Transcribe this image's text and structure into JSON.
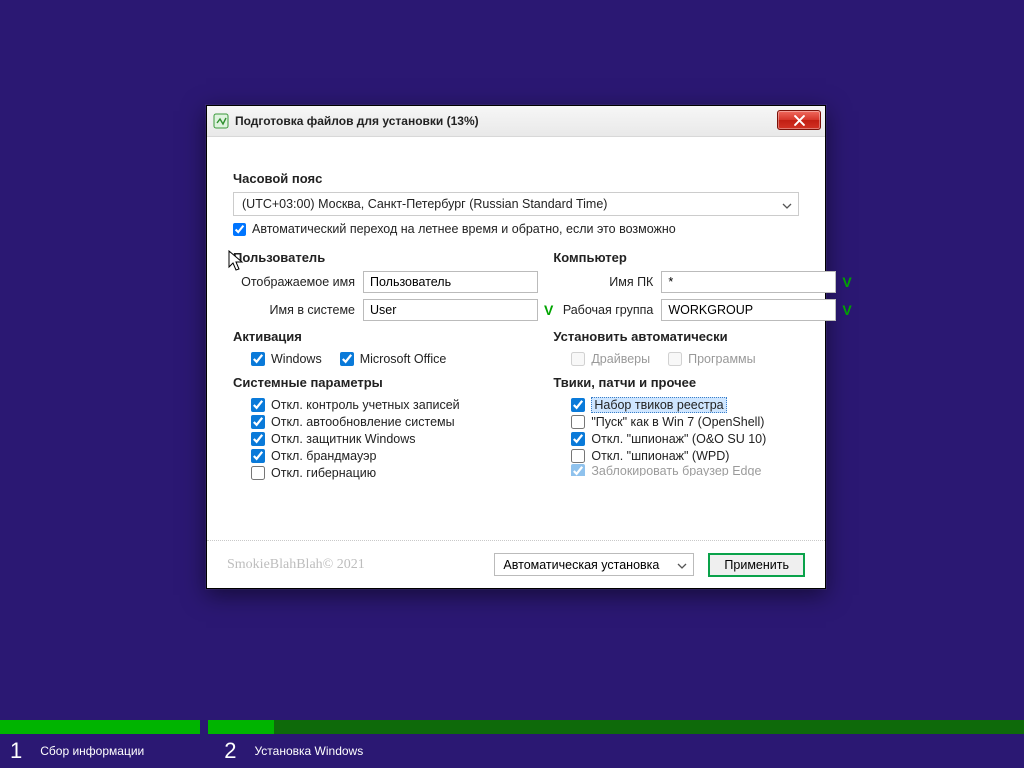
{
  "window": {
    "title": "Подготовка файлов для установки (13%)"
  },
  "timezone": {
    "heading": "Часовой пояс",
    "selected": "(UTC+03:00) Москва, Санкт-Петербург (Russian Standard Time)",
    "dst_checked": true,
    "dst_label": "Автоматический переход на летнее время и обратно, если это возможно"
  },
  "user": {
    "heading": "Пользователь",
    "display_label": "Отображаемое имя",
    "display_value": "Пользователь",
    "system_label": "Имя в системе",
    "system_value": "User",
    "valid_mark": "V"
  },
  "computer": {
    "heading": "Компьютер",
    "pc_label": "Имя ПК",
    "pc_value": "*",
    "wg_label": "Рабочая группа",
    "wg_value": "WORKGROUP",
    "valid_mark": "V"
  },
  "activation": {
    "heading": "Активация",
    "windows_label": "Windows",
    "windows_checked": true,
    "office_label": "Microsoft Office",
    "office_checked": true
  },
  "autoinstall": {
    "heading": "Установить автоматически",
    "drivers_label": "Драйверы",
    "drivers_checked": false,
    "programs_label": "Программы",
    "programs_checked": false,
    "disabled": true
  },
  "sysparams": {
    "heading": "Системные параметры",
    "items": [
      {
        "label": "Откл. контроль учетных записей",
        "checked": true
      },
      {
        "label": "Откл. автообновление системы",
        "checked": true
      },
      {
        "label": "Откл. защитник Windows",
        "checked": true
      },
      {
        "label": "Откл. брандмауэр",
        "checked": true
      },
      {
        "label": "Откл. гибернацию",
        "checked": false
      }
    ]
  },
  "tweaks": {
    "heading": "Твики, патчи и прочее",
    "items": [
      {
        "label": "Набор твиков реестра",
        "checked": true,
        "selected": true
      },
      {
        "label": "\"Пуск\" как в Win 7 (OpenShell)",
        "checked": false
      },
      {
        "label": "Откл. \"шпионаж\" (O&O SU 10)",
        "checked": true
      },
      {
        "label": "Откл. \"шпионаж\" (WPD)",
        "checked": false
      },
      {
        "label": "Заблокировать браузер Edge",
        "checked": true,
        "cut": true
      }
    ]
  },
  "footer": {
    "credit": "SmokieBlahBlah© 2021",
    "mode_selected": "Автоматическая установка",
    "apply": "Применить"
  },
  "steps": {
    "s1_num": "1",
    "s1_label": "Сбор информации",
    "s2_num": "2",
    "s2_label": "Установка Windows"
  }
}
